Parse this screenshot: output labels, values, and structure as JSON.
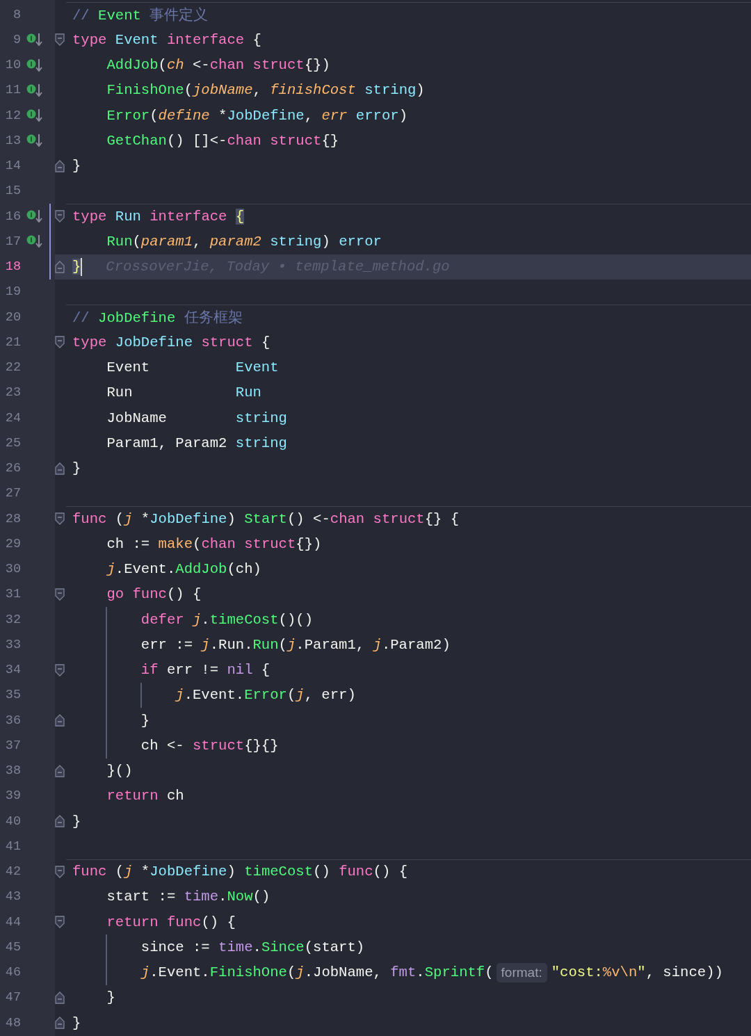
{
  "lines": [
    {
      "number": "8",
      "separator": true,
      "implemented": false,
      "changed": false,
      "current": false,
      "segments": [
        {
          "kind": "code",
          "tokens": [
            {
              "text": "// ",
              "kind": "comment"
            },
            {
              "text": "Event",
              "kind": "reference"
            },
            {
              "text": " 事件定义",
              "kind": "comment"
            }
          ]
        }
      ]
    },
    {
      "number": "9",
      "separator": false,
      "implemented": true,
      "changed": false,
      "current": false,
      "fold_marker": {
        "kind": "start"
      },
      "segments": [
        {
          "kind": "code",
          "tokens": [
            {
              "text": "type ",
              "kind": "keyword"
            },
            {
              "text": "Event ",
              "kind": "type"
            },
            {
              "text": "interface ",
              "kind": "keyword"
            },
            {
              "text": "{",
              "kind": "plain"
            }
          ]
        }
      ]
    },
    {
      "number": "10",
      "separator": false,
      "implemented": true,
      "changed": false,
      "current": false,
      "indent": [
        {
          "guide": false
        }
      ],
      "segments": [
        {
          "kind": "code",
          "tokens": [
            {
              "text": "AddJob",
              "kind": "function"
            },
            {
              "text": "(",
              "kind": "plain"
            },
            {
              "text": "ch",
              "kind": "parameter"
            },
            {
              "text": " <-",
              "kind": "plain"
            },
            {
              "text": "chan struct",
              "kind": "keyword"
            },
            {
              "text": "{})",
              "kind": "plain"
            }
          ]
        }
      ]
    },
    {
      "number": "11",
      "separator": false,
      "implemented": true,
      "changed": false,
      "current": false,
      "indent": [
        {
          "guide": false
        }
      ],
      "segments": [
        {
          "kind": "code",
          "tokens": [
            {
              "text": "FinishOne",
              "kind": "function"
            },
            {
              "text": "(",
              "kind": "plain"
            },
            {
              "text": "jobName",
              "kind": "parameter"
            },
            {
              "text": ", ",
              "kind": "plain"
            },
            {
              "text": "finishCost ",
              "kind": "parameter"
            },
            {
              "text": "string",
              "kind": "type"
            },
            {
              "text": ")",
              "kind": "plain"
            }
          ]
        }
      ]
    },
    {
      "number": "12",
      "separator": false,
      "implemented": true,
      "changed": false,
      "current": false,
      "indent": [
        {
          "guide": false
        }
      ],
      "segments": [
        {
          "kind": "code",
          "tokens": [
            {
              "text": "Error",
              "kind": "function"
            },
            {
              "text": "(",
              "kind": "plain"
            },
            {
              "text": "define",
              "kind": "parameter"
            },
            {
              "text": " *",
              "kind": "plain"
            },
            {
              "text": "JobDefine",
              "kind": "type"
            },
            {
              "text": ", ",
              "kind": "plain"
            },
            {
              "text": "err ",
              "kind": "parameter"
            },
            {
              "text": "error",
              "kind": "type"
            },
            {
              "text": ")",
              "kind": "plain"
            }
          ]
        }
      ]
    },
    {
      "number": "13",
      "separator": false,
      "implemented": true,
      "changed": false,
      "current": false,
      "indent": [
        {
          "guide": false
        }
      ],
      "segments": [
        {
          "kind": "code",
          "tokens": [
            {
              "text": "GetChan",
              "kind": "function"
            },
            {
              "text": "() []<-",
              "kind": "plain"
            },
            {
              "text": "chan struct",
              "kind": "keyword"
            },
            {
              "text": "{}",
              "kind": "plain"
            }
          ]
        }
      ]
    },
    {
      "number": "14",
      "separator": false,
      "implemented": false,
      "changed": false,
      "current": false,
      "fold_marker": {
        "kind": "end"
      },
      "segments": [
        {
          "kind": "code",
          "tokens": [
            {
              "text": "}",
              "kind": "plain"
            }
          ]
        }
      ]
    },
    {
      "number": "15",
      "separator": false,
      "implemented": false,
      "changed": false,
      "current": false
    },
    {
      "number": "16",
      "separator": true,
      "implemented": true,
      "changed": true,
      "current": false,
      "fold_marker": {
        "kind": "start"
      },
      "segments": [
        {
          "kind": "code",
          "tokens": [
            {
              "text": "type ",
              "kind": "keyword"
            },
            {
              "text": "Run ",
              "kind": "type"
            },
            {
              "text": "interface ",
              "kind": "keyword"
            },
            {
              "text": "{",
              "kind": "match"
            }
          ]
        }
      ]
    },
    {
      "number": "17",
      "separator": false,
      "implemented": true,
      "changed": true,
      "current": false,
      "indent": [
        {
          "guide": false
        }
      ],
      "segments": [
        {
          "kind": "code",
          "tokens": [
            {
              "text": "Run",
              "kind": "function"
            },
            {
              "text": "(",
              "kind": "plain"
            },
            {
              "text": "param1",
              "kind": "parameter"
            },
            {
              "text": ", ",
              "kind": "plain"
            },
            {
              "text": "param2 ",
              "kind": "parameter"
            },
            {
              "text": "string",
              "kind": "type"
            },
            {
              "text": ") ",
              "kind": "plain"
            },
            {
              "text": "error",
              "kind": "type"
            }
          ]
        }
      ]
    },
    {
      "number": "18",
      "separator": false,
      "implemented": false,
      "changed": true,
      "current": true,
      "fold_marker": {
        "kind": "end"
      },
      "segments": [
        {
          "kind": "code",
          "tokens": [
            {
              "text": "}",
              "kind": "match"
            }
          ]
        },
        {
          "kind": "blame",
          "text": "CrossoverJie, Today • template_method.go"
        }
      ]
    },
    {
      "number": "19",
      "separator": false,
      "implemented": false,
      "changed": false,
      "current": false
    },
    {
      "number": "20",
      "separator": true,
      "implemented": false,
      "changed": false,
      "current": false,
      "segments": [
        {
          "kind": "code",
          "tokens": [
            {
              "text": "// ",
              "kind": "comment"
            },
            {
              "text": "JobDefine",
              "kind": "reference"
            },
            {
              "text": " 任务框架",
              "kind": "comment"
            }
          ]
        }
      ]
    },
    {
      "number": "21",
      "separator": false,
      "implemented": false,
      "changed": false,
      "current": false,
      "fold_marker": {
        "kind": "start"
      },
      "segments": [
        {
          "kind": "code",
          "tokens": [
            {
              "text": "type ",
              "kind": "keyword"
            },
            {
              "text": "JobDefine ",
              "kind": "type"
            },
            {
              "text": "struct ",
              "kind": "keyword"
            },
            {
              "text": "{",
              "kind": "plain"
            }
          ]
        }
      ]
    },
    {
      "number": "22",
      "separator": false,
      "implemented": false,
      "changed": false,
      "current": false,
      "indent": [
        {
          "guide": false
        }
      ],
      "segments": [
        {
          "kind": "code",
          "tokens": [
            {
              "text": "Event          ",
              "kind": "plain"
            },
            {
              "text": "Event",
              "kind": "type"
            }
          ]
        }
      ]
    },
    {
      "number": "23",
      "separator": false,
      "implemented": false,
      "changed": false,
      "current": false,
      "indent": [
        {
          "guide": false
        }
      ],
      "segments": [
        {
          "kind": "code",
          "tokens": [
            {
              "text": "Run            ",
              "kind": "plain"
            },
            {
              "text": "Run",
              "kind": "type"
            }
          ]
        }
      ]
    },
    {
      "number": "24",
      "separator": false,
      "implemented": false,
      "changed": false,
      "current": false,
      "indent": [
        {
          "guide": false
        }
      ],
      "segments": [
        {
          "kind": "code",
          "tokens": [
            {
              "text": "JobName        ",
              "kind": "plain"
            },
            {
              "text": "string",
              "kind": "type"
            }
          ]
        }
      ]
    },
    {
      "number": "25",
      "separator": false,
      "implemented": false,
      "changed": false,
      "current": false,
      "indent": [
        {
          "guide": false
        }
      ],
      "segments": [
        {
          "kind": "code",
          "tokens": [
            {
              "text": "Param1, Param2 ",
              "kind": "plain"
            },
            {
              "text": "string",
              "kind": "type"
            }
          ]
        }
      ]
    },
    {
      "number": "26",
      "separator": false,
      "implemented": false,
      "changed": false,
      "current": false,
      "fold_marker": {
        "kind": "end"
      },
      "segments": [
        {
          "kind": "code",
          "tokens": [
            {
              "text": "}",
              "kind": "plain"
            }
          ]
        }
      ]
    },
    {
      "number": "27",
      "separator": false,
      "implemented": false,
      "changed": false,
      "current": false
    },
    {
      "number": "28",
      "separator": true,
      "implemented": false,
      "changed": false,
      "current": false,
      "fold_marker": {
        "kind": "start"
      },
      "segments": [
        {
          "kind": "code",
          "tokens": [
            {
              "text": "func ",
              "kind": "keyword"
            },
            {
              "text": "(",
              "kind": "plain"
            },
            {
              "text": "j",
              "kind": "parameter"
            },
            {
              "text": " *",
              "kind": "plain"
            },
            {
              "text": "JobDefine",
              "kind": "type"
            },
            {
              "text": ") ",
              "kind": "plain"
            },
            {
              "text": "Start",
              "kind": "function"
            },
            {
              "text": "() <-",
              "kind": "plain"
            },
            {
              "text": "chan struct",
              "kind": "keyword"
            },
            {
              "text": "{} {",
              "kind": "plain"
            }
          ]
        }
      ]
    },
    {
      "number": "29",
      "separator": false,
      "implemented": false,
      "changed": false,
      "current": false,
      "indent": [
        {
          "guide": false
        }
      ],
      "segments": [
        {
          "kind": "code",
          "tokens": [
            {
              "text": "ch := ",
              "kind": "plain"
            },
            {
              "text": "make",
              "kind": "builtin"
            },
            {
              "text": "(",
              "kind": "plain"
            },
            {
              "text": "chan struct",
              "kind": "keyword"
            },
            {
              "text": "{})",
              "kind": "plain"
            }
          ]
        }
      ]
    },
    {
      "number": "30",
      "separator": false,
      "implemented": false,
      "changed": false,
      "current": false,
      "indent": [
        {
          "guide": false
        }
      ],
      "segments": [
        {
          "kind": "code",
          "tokens": [
            {
              "text": "j",
              "kind": "parameter"
            },
            {
              "text": ".Event.",
              "kind": "plain"
            },
            {
              "text": "AddJob",
              "kind": "function"
            },
            {
              "text": "(ch)",
              "kind": "plain"
            }
          ]
        }
      ]
    },
    {
      "number": "31",
      "separator": false,
      "implemented": false,
      "changed": false,
      "current": false,
      "fold_marker": {
        "kind": "start"
      },
      "indent": [
        {
          "guide": false
        }
      ],
      "segments": [
        {
          "kind": "code",
          "tokens": [
            {
              "text": "go func",
              "kind": "keyword"
            },
            {
              "text": "() {",
              "kind": "plain"
            }
          ]
        }
      ]
    },
    {
      "number": "32",
      "separator": false,
      "implemented": false,
      "changed": false,
      "current": false,
      "indent": [
        {
          "guide": false
        },
        {
          "guide": true
        }
      ],
      "segments": [
        {
          "kind": "code",
          "tokens": [
            {
              "text": "defer ",
              "kind": "keyword"
            },
            {
              "text": "j",
              "kind": "parameter"
            },
            {
              "text": ".",
              "kind": "plain"
            },
            {
              "text": "timeCost",
              "kind": "function"
            },
            {
              "text": "()()",
              "kind": "plain"
            }
          ]
        }
      ]
    },
    {
      "number": "33",
      "separator": false,
      "implemented": false,
      "changed": false,
      "current": false,
      "indent": [
        {
          "guide": false
        },
        {
          "guide": true
        }
      ],
      "segments": [
        {
          "kind": "code",
          "tokens": [
            {
              "text": "err := ",
              "kind": "plain"
            },
            {
              "text": "j",
              "kind": "parameter"
            },
            {
              "text": ".Run.",
              "kind": "plain"
            },
            {
              "text": "Run",
              "kind": "function"
            },
            {
              "text": "(",
              "kind": "plain"
            },
            {
              "text": "j",
              "kind": "parameter"
            },
            {
              "text": ".Param1, ",
              "kind": "plain"
            },
            {
              "text": "j",
              "kind": "parameter"
            },
            {
              "text": ".Param2)",
              "kind": "plain"
            }
          ]
        }
      ]
    },
    {
      "number": "34",
      "separator": false,
      "implemented": false,
      "changed": false,
      "current": false,
      "fold_marker": {
        "kind": "start"
      },
      "indent": [
        {
          "guide": false
        },
        {
          "guide": true
        }
      ],
      "segments": [
        {
          "kind": "code",
          "tokens": [
            {
              "text": "if ",
              "kind": "keyword"
            },
            {
              "text": "err != ",
              "kind": "plain"
            },
            {
              "text": "nil",
              "kind": "constant"
            },
            {
              "text": " {",
              "kind": "plain"
            }
          ]
        }
      ]
    },
    {
      "number": "35",
      "separator": false,
      "implemented": false,
      "changed": false,
      "current": false,
      "indent": [
        {
          "guide": false
        },
        {
          "guide": true
        },
        {
          "guide": true
        }
      ],
      "segments": [
        {
          "kind": "code",
          "tokens": [
            {
              "text": "j",
              "kind": "parameter"
            },
            {
              "text": ".Event.",
              "kind": "plain"
            },
            {
              "text": "Error",
              "kind": "function"
            },
            {
              "text": "(",
              "kind": "plain"
            },
            {
              "text": "j",
              "kind": "parameter"
            },
            {
              "text": ", err)",
              "kind": "plain"
            }
          ]
        }
      ]
    },
    {
      "number": "36",
      "separator": false,
      "implemented": false,
      "changed": false,
      "current": false,
      "fold_marker": {
        "kind": "end"
      },
      "indent": [
        {
          "guide": false
        },
        {
          "guide": true
        }
      ],
      "segments": [
        {
          "kind": "code",
          "tokens": [
            {
              "text": "}",
              "kind": "plain"
            }
          ]
        }
      ]
    },
    {
      "number": "37",
      "separator": false,
      "implemented": false,
      "changed": false,
      "current": false,
      "indent": [
        {
          "guide": false
        },
        {
          "guide": true
        }
      ],
      "segments": [
        {
          "kind": "code",
          "tokens": [
            {
              "text": "ch <- ",
              "kind": "plain"
            },
            {
              "text": "struct",
              "kind": "keyword"
            },
            {
              "text": "{}{}",
              "kind": "plain"
            }
          ]
        }
      ]
    },
    {
      "number": "38",
      "separator": false,
      "implemented": false,
      "changed": false,
      "current": false,
      "fold_marker": {
        "kind": "end"
      },
      "indent": [
        {
          "guide": false
        }
      ],
      "segments": [
        {
          "kind": "code",
          "tokens": [
            {
              "text": "}()",
              "kind": "plain"
            }
          ]
        }
      ]
    },
    {
      "number": "39",
      "separator": false,
      "implemented": false,
      "changed": false,
      "current": false,
      "indent": [
        {
          "guide": false
        }
      ],
      "segments": [
        {
          "kind": "code",
          "tokens": [
            {
              "text": "return ",
              "kind": "keyword"
            },
            {
              "text": "ch",
              "kind": "plain"
            }
          ]
        }
      ]
    },
    {
      "number": "40",
      "separator": false,
      "implemented": false,
      "changed": false,
      "current": false,
      "fold_marker": {
        "kind": "end"
      },
      "segments": [
        {
          "kind": "code",
          "tokens": [
            {
              "text": "}",
              "kind": "plain"
            }
          ]
        }
      ]
    },
    {
      "number": "41",
      "separator": false,
      "implemented": false,
      "changed": false,
      "current": false
    },
    {
      "number": "42",
      "separator": true,
      "implemented": false,
      "changed": false,
      "current": false,
      "fold_marker": {
        "kind": "start"
      },
      "segments": [
        {
          "kind": "code",
          "tokens": [
            {
              "text": "func ",
              "kind": "keyword"
            },
            {
              "text": "(",
              "kind": "plain"
            },
            {
              "text": "j",
              "kind": "parameter"
            },
            {
              "text": " *",
              "kind": "plain"
            },
            {
              "text": "JobDefine",
              "kind": "type"
            },
            {
              "text": ") ",
              "kind": "plain"
            },
            {
              "text": "timeCost",
              "kind": "function"
            },
            {
              "text": "() ",
              "kind": "plain"
            },
            {
              "text": "func",
              "kind": "keyword"
            },
            {
              "text": "() {",
              "kind": "plain"
            }
          ]
        }
      ]
    },
    {
      "number": "43",
      "separator": false,
      "implemented": false,
      "changed": false,
      "current": false,
      "indent": [
        {
          "guide": false
        }
      ],
      "segments": [
        {
          "kind": "code",
          "tokens": [
            {
              "text": "start := ",
              "kind": "plain"
            },
            {
              "text": "time",
              "kind": "package"
            },
            {
              "text": ".",
              "kind": "plain"
            },
            {
              "text": "Now",
              "kind": "function"
            },
            {
              "text": "()",
              "kind": "plain"
            }
          ]
        }
      ]
    },
    {
      "number": "44",
      "separator": false,
      "implemented": false,
      "changed": false,
      "current": false,
      "fold_marker": {
        "kind": "start"
      },
      "indent": [
        {
          "guide": false
        }
      ],
      "segments": [
        {
          "kind": "code",
          "tokens": [
            {
              "text": "return func",
              "kind": "keyword"
            },
            {
              "text": "() {",
              "kind": "plain"
            }
          ]
        }
      ]
    },
    {
      "number": "45",
      "separator": false,
      "implemented": false,
      "changed": false,
      "current": false,
      "indent": [
        {
          "guide": false
        },
        {
          "guide": true
        }
      ],
      "segments": [
        {
          "kind": "code",
          "tokens": [
            {
              "text": "since := ",
              "kind": "plain"
            },
            {
              "text": "time",
              "kind": "package"
            },
            {
              "text": ".",
              "kind": "plain"
            },
            {
              "text": "Since",
              "kind": "function"
            },
            {
              "text": "(start)",
              "kind": "plain"
            }
          ]
        }
      ]
    },
    {
      "number": "46",
      "separator": false,
      "implemented": false,
      "changed": false,
      "current": false,
      "indent": [
        {
          "guide": false
        },
        {
          "guide": true
        }
      ],
      "segments": [
        {
          "kind": "code",
          "tokens": [
            {
              "text": "j",
              "kind": "parameter"
            },
            {
              "text": ".Event.",
              "kind": "plain"
            },
            {
              "text": "FinishOne",
              "kind": "function"
            },
            {
              "text": "(",
              "kind": "plain"
            },
            {
              "text": "j",
              "kind": "parameter"
            },
            {
              "text": ".JobName, ",
              "kind": "plain"
            },
            {
              "text": "fmt",
              "kind": "package"
            },
            {
              "text": ".",
              "kind": "plain"
            },
            {
              "text": "Sprintf",
              "kind": "function"
            },
            {
              "text": "(",
              "kind": "plain"
            }
          ]
        },
        {
          "kind": "hint",
          "text": "format:"
        },
        {
          "kind": "code",
          "tokens": [
            {
              "text": "\"cost:",
              "kind": "string"
            },
            {
              "text": "%v\\n",
              "kind": "escape"
            },
            {
              "text": "\"",
              "kind": "string"
            },
            {
              "text": ", since))",
              "kind": "plain"
            }
          ]
        }
      ]
    },
    {
      "number": "47",
      "separator": false,
      "implemented": false,
      "changed": false,
      "current": false,
      "fold_marker": {
        "kind": "end"
      },
      "indent": [
        {
          "guide": false
        }
      ],
      "segments": [
        {
          "kind": "code",
          "tokens": [
            {
              "text": "}",
              "kind": "plain"
            }
          ]
        }
      ]
    },
    {
      "number": "48",
      "separator": false,
      "implemented": false,
      "changed": false,
      "current": false,
      "fold_marker": {
        "kind": "end"
      },
      "segments": [
        {
          "kind": "code",
          "tokens": [
            {
              "text": "}",
              "kind": "plain"
            }
          ]
        }
      ]
    }
  ]
}
